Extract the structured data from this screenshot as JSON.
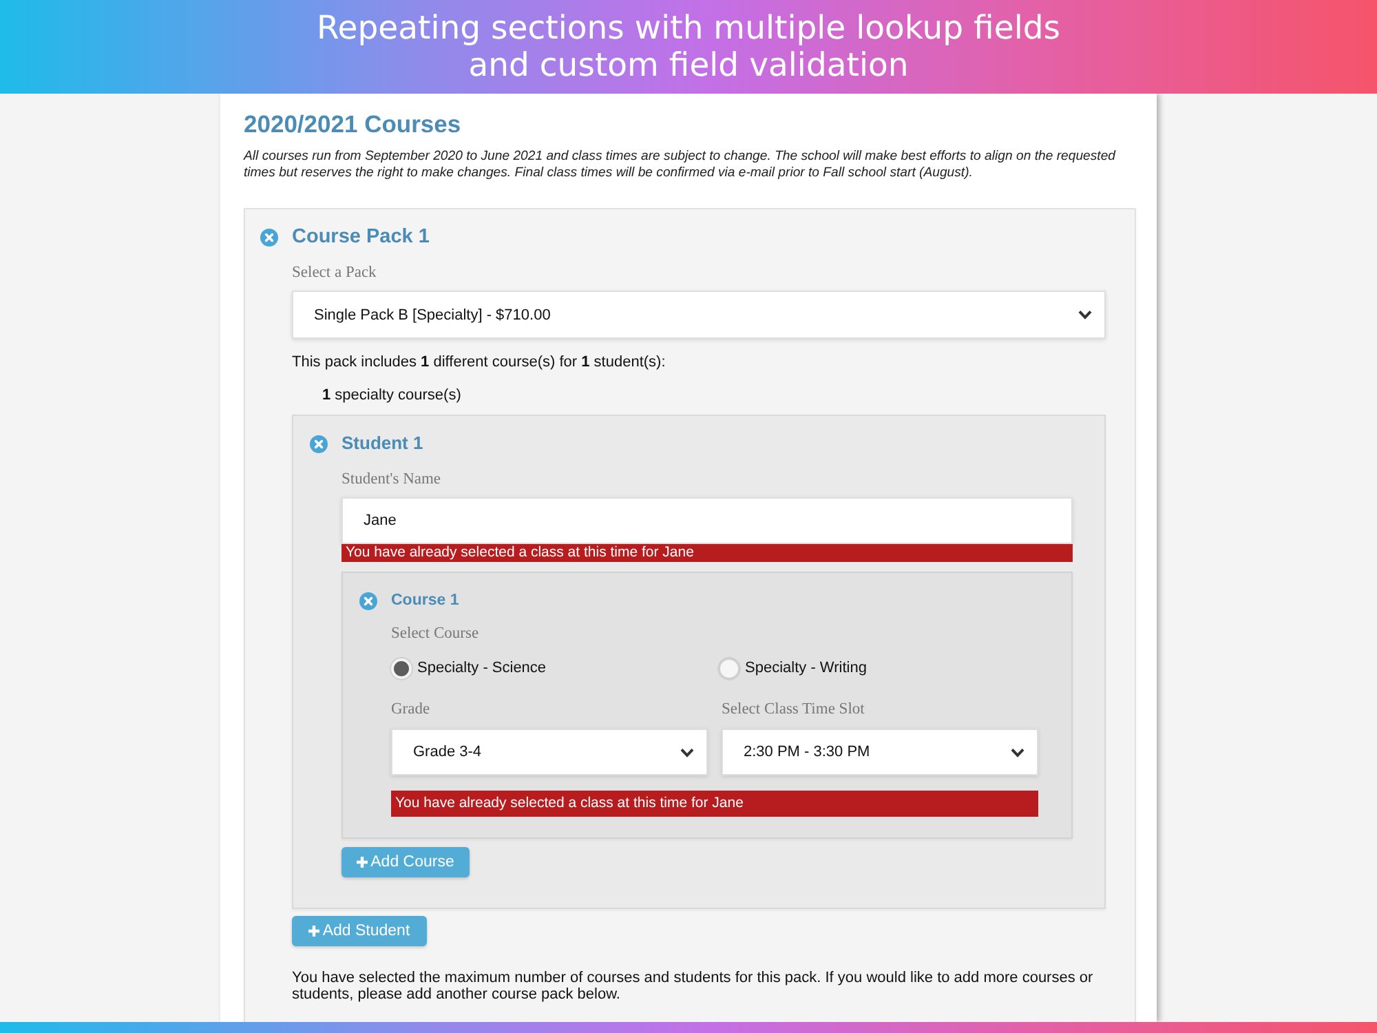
{
  "banner": {
    "title_lines": [
      "Repeating sections with multiple lookup fields",
      "and custom field validation"
    ]
  },
  "page": {
    "heading": "2020/2021 Courses",
    "notice": "All courses run from September 2020 to June 2021 and class times are subject to change. The school will make best efforts to align on the requested times but reserves the right to make changes. Final class times will be confirmed via e-mail prior to Fall school start (August)."
  },
  "course_packs": [
    {
      "title": "Course Pack 1",
      "pack_select": {
        "label": "Select a Pack",
        "value": "Single Pack B [Specialty] - $710.00"
      },
      "summary": "This pack includes **1** different course(s) for **1** student(s):",
      "summary_items": [
        "**1** specialty course(s)"
      ],
      "students": [
        {
          "title": "Student 1",
          "name_field": {
            "label": "Student's Name",
            "value": "Jane",
            "error": "You have already selected a class at this time for Jane"
          },
          "courses": [
            {
              "title": "Course 1",
              "course_choice": {
                "label": "Select Course",
                "options": [
                  {
                    "label": "Specialty - Science",
                    "selected": true
                  },
                  {
                    "label": "Specialty - Writing",
                    "selected": false
                  }
                ]
              },
              "selects": [
                {
                  "label": "Grade",
                  "value": "Grade 3-4"
                },
                {
                  "label": "Select Class Time Slot",
                  "value": "2:30 PM - 3:30 PM"
                }
              ],
              "error": "You have already selected a class at this time for Jane"
            }
          ],
          "add_course_button": "Add Course"
        }
      ],
      "add_student_button": "Add Student",
      "limit_note": "You have selected the maximum number of courses and students for this pack. If you would like to add more courses or students, please add another course pack below."
    }
  ]
}
